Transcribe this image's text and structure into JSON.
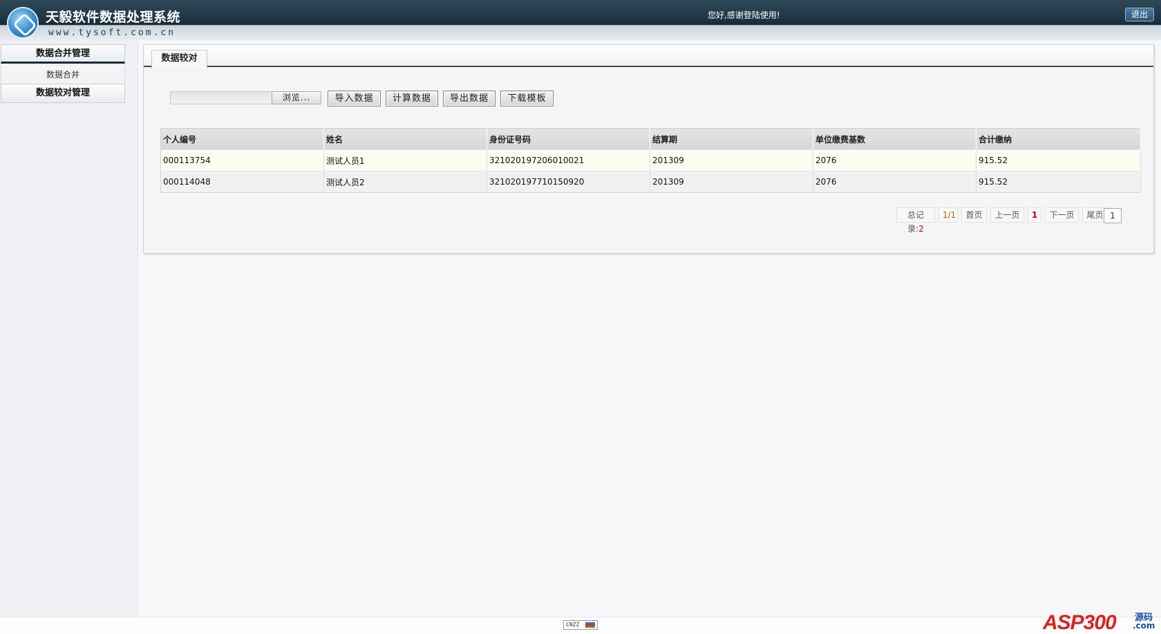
{
  "header": {
    "title": "天毅软件数据处理系统",
    "site": "www.tysoft.com.cn",
    "welcome": "您好,感谢登陆使用!",
    "logout_label": "退出"
  },
  "sidebar": {
    "groups": [
      {
        "label": "数据合并管理",
        "items": [
          {
            "label": "数据合并"
          }
        ]
      },
      {
        "label": "数据较对管理",
        "items": []
      }
    ]
  },
  "main": {
    "tab": "数据较对",
    "browse_label": "浏览...",
    "buttons": {
      "import": "导入数据",
      "compute": "计算数据",
      "export": "导出数据",
      "template": "下载模板"
    },
    "table": {
      "columns": [
        "个人编号",
        "姓名",
        "身份证号码",
        "结算期",
        "单位缴费基数",
        "合计缴纳"
      ],
      "rows": [
        [
          "000113754",
          "测试人员1",
          "321020197206010021",
          "201309",
          "2076",
          "915.52"
        ],
        [
          "000114048",
          "测试人员2",
          "321020197710150920",
          "201309",
          "2076",
          "915.52"
        ]
      ]
    },
    "pager": {
      "total_label": "总记录:",
      "total_value": "2",
      "page_of": "1/1",
      "first": "首页",
      "prev": "上一页",
      "current": "1",
      "next": "下一页",
      "last": "尾页",
      "goto": "1"
    }
  },
  "footer": {
    "badge": "CNZZ",
    "watermark": "ASP300",
    "watermark_cn": "源码",
    "watermark_com": ".com"
  }
}
